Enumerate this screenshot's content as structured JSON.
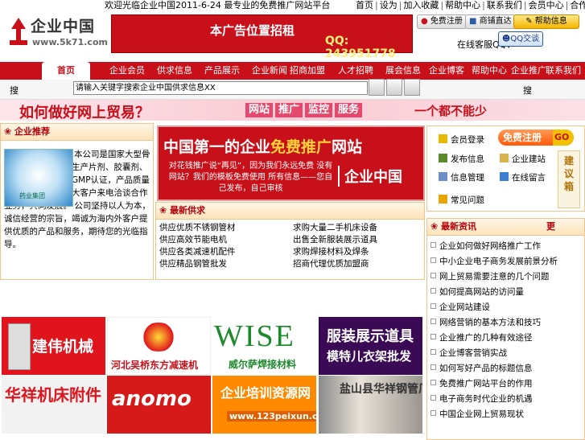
{
  "topbar": {
    "welcome": "欢迎光临企业中国2011-6-24 最专业的免费推广网站平台",
    "links": [
      "首页",
      "设为",
      "加入收藏",
      "帮助中心",
      "联系我们",
      "会员中心",
      "合作伙伴"
    ]
  },
  "logo": {
    "name": "企业中国",
    "url": "www.5k71.com"
  },
  "ad_banner": {
    "headline": "本广告位置招租",
    "contact": "QQ: 243951778"
  },
  "header_buttons": {
    "register": "免费注册",
    "shops": "商铺直达",
    "help": "帮助信息",
    "qq_text": "在线客服QQ：",
    "qq_chat": "QQ交谈"
  },
  "nav": {
    "items": [
      "首页",
      "企业会员",
      "供求信息",
      "产品展示",
      "企业新闻",
      "招商加盟",
      "人才招聘",
      "展会信息",
      "企业博客",
      "帮助中心",
      "企业推广",
      "联系我们"
    ]
  },
  "search": {
    "label": "搜",
    "value": "请输入关键字搜索企业中国供求信息XX",
    "end": "搜"
  },
  "slogan": {
    "question": "如何做好网上贸易？",
    "tags": [
      "网站",
      "推广",
      "监控",
      "服务"
    ],
    "tail": "一个都不能少"
  },
  "left_panel": {
    "title": "企业推荐",
    "image_label": "药业集团",
    "text": "本公司是国家大型骨干制药企业，主要生产片剂、胶囊剂、颗粒剂等，已通过GMP认证，产品质量稳定可靠，欢迎广大客户来电洽谈合作业务，共同发展。 公司坚持以人为本，诚信经营的宗旨，竭诚为海内外客户提供优质的产品和服务，期待您的光临指导。"
  },
  "mid_banner": {
    "line1_a": "中国第一的企业",
    "line1_b": "免费推广",
    "line1_c": "网站",
    "desc": "对花钱推广说“再见”，因为我们永远免费 没有网站？我们的模板免费使用 所有信息——您自己发布，自己审核",
    "brand": "企业中国"
  },
  "mid_panel": {
    "title": "最新供求",
    "items": [
      "供应优质不锈钢管材",
      "求购大量二手机床设备",
      "供应高效节能电机",
      "出售全新服装展示道具",
      "供应各类减速机配件",
      "求购焊接材料及焊条",
      "供应精品钢管批发",
      "招商代理优质加盟商"
    ]
  },
  "right_panel": {
    "register": "免费注册",
    "go": "GO",
    "items": [
      "会员登录",
      "发布信息",
      "企业建站",
      "信息管理",
      "在线留言",
      "常见问题"
    ],
    "suggest": [
      "建",
      "议",
      "箱"
    ]
  },
  "news_panel": {
    "title": "最新资讯",
    "more": "更",
    "items": [
      "企业如何做好网络推广工作",
      "中小企业电子商务发展前景分析",
      "网上贸易需要注意的几个问题",
      "如何提高网站的访问量",
      "企业网站建设",
      "网络营销的基本方法和技巧",
      "企业推广的几种有效途径",
      "企业博客营销实战",
      "如何写好产品的标题信息",
      "免费推广网站平台的作用",
      "电子商务时代企业的机遇",
      "中国企业网上贸易现状"
    ]
  },
  "logos": [
    {
      "name": "建伟机械",
      "bg": "#e0141c",
      "fg": "#ffffff"
    },
    {
      "name": "河北吴桥东方减速机",
      "bg": "#ffffff",
      "fg": "#c8101a"
    },
    {
      "name": "WISE",
      "sub": "威尔萨焊接材料",
      "bg": "#ffffff",
      "fg": "#1d8a2c"
    },
    {
      "name": "服装展示道具",
      "sub": "模特儿衣架批发",
      "bg": "#3a0a55",
      "fg": "#ffffff"
    },
    {
      "name": "华祥机床附件",
      "bg": "#f2f2f2",
      "fg": "#e0141c"
    },
    {
      "name": "anomo",
      "bg": "#d61a1a",
      "fg": "#ffffff"
    },
    {
      "name": "企业培训资源网",
      "sub": "www.123peixun.cn",
      "bg": "#ff8a00",
      "fg": "#ffffff"
    },
    {
      "name": "盐山县华祥钢管厂",
      "bg": "#c9c2b8",
      "fg": "#333333"
    }
  ],
  "colors": {
    "brand_red": "#c8101a",
    "panel_border": "#f1c58a",
    "panel_title": "#b3000b"
  }
}
